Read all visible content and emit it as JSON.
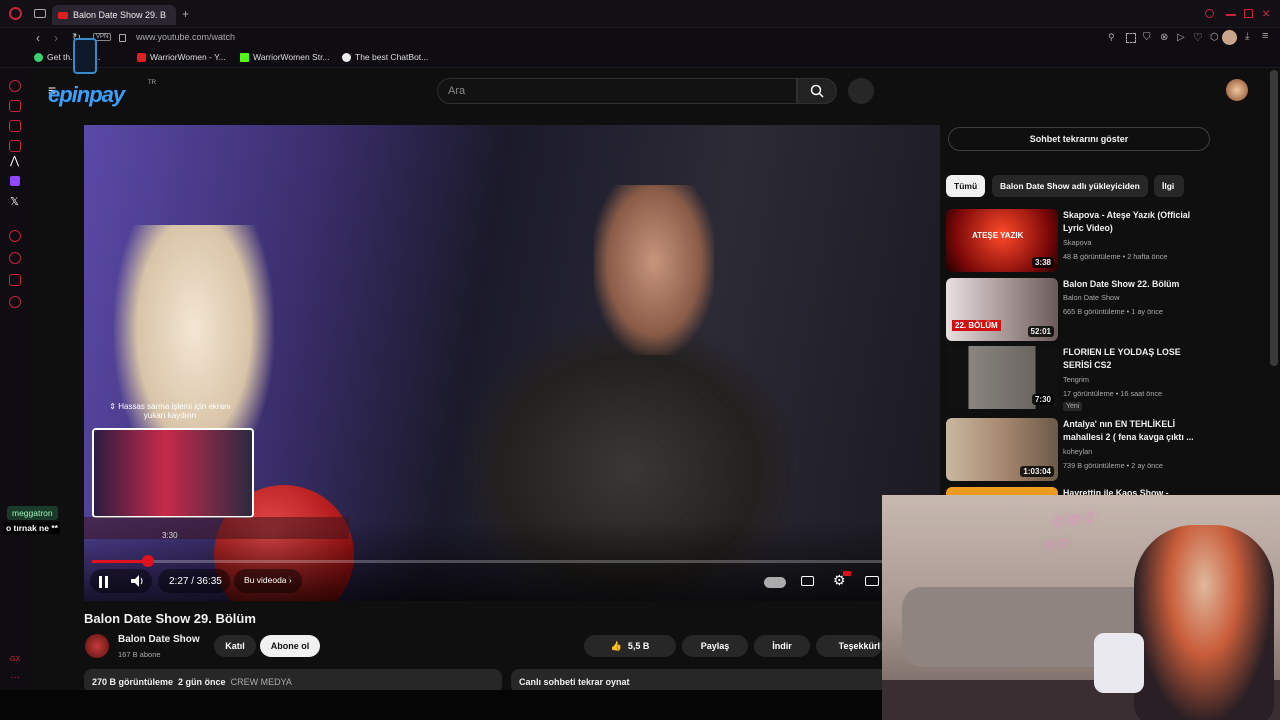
{
  "browser": {
    "tab_title": "Balon Date Show 29. B",
    "vpn_label": "VPN",
    "url": "www.youtube.com/watch",
    "bookmarks": [
      "Get th... File...",
      "WarriorWomen - Y...",
      "WarriorWomen Str...",
      "The best ChatBot..."
    ]
  },
  "youtube": {
    "logo_text": "epinpay",
    "logo_sup": "TR",
    "search_placeholder": "Ara"
  },
  "video": {
    "preview_hint": "⇕ Hassas sarma işlemi için ekranı yukarı kaydırın",
    "preview_time": "3:30",
    "current_time": "2:27 / 36:35",
    "chapter_label": "Bu videoda",
    "progress": 0.067
  },
  "meta": {
    "title": "Balon Date Show 29. Bölüm",
    "channel": "Balon Date Show",
    "subscribers": "167 B abone",
    "join": "Katıl",
    "subscribe": "Abone ol",
    "likes": "5,5 B",
    "share": "Paylaş",
    "download": "İndir",
    "thanks": "Teşekkürl",
    "views": "270 B görüntüleme",
    "date": "2 gün önce",
    "tag": "CREW MEDYA",
    "chat_replay": "Canlı sohbeti tekrar oynat"
  },
  "right": {
    "show_chat": "Sohbet tekrarını göster",
    "chips": [
      "Tümü",
      "Balon Date Show adlı yükleyiciden",
      "İlgi"
    ],
    "recommendations": [
      {
        "title": "Skapova - Ateşe Yazık (Official Lyric Video)",
        "channel": "Skapova",
        "stats": "48 B görüntüleme • 2 hafta önce",
        "duration": "3:38",
        "thumb_text": "ATEŞE YAZIK",
        "badge": ""
      },
      {
        "title": "Balon Date Show 22. Bölüm",
        "channel": "Balon Date Show",
        "stats": "665 B görüntüleme • 1 ay önce",
        "duration": "52:01",
        "thumb_text": "22. BÖLÜM",
        "badge": ""
      },
      {
        "title": "FLORIEN LE YOLDAŞ LOSE SERİSİ CS2",
        "channel": "Tengrim",
        "stats": "17 görüntüleme • 16 saat önce",
        "duration": "7:30",
        "thumb_text": "",
        "badge": "Yeni"
      },
      {
        "title": "Antalya' nın EN TEHLİKELİ mahallesi 2 ( fena kavga çıktı ...",
        "channel": "koheylan",
        "stats": "739 B görüntüleme • 2 ay önce",
        "duration": "1:03:04",
        "thumb_text": "",
        "badge": ""
      },
      {
        "title": "Hayrettin ile Kaos Show -",
        "channel": "",
        "stats": "",
        "duration": "",
        "thumb_text": "",
        "badge": ""
      }
    ]
  },
  "overlay": {
    "chat_user": "meggatron",
    "chat_message": "o tırnak ne **",
    "sidebar_bottom": "GX"
  },
  "colors": {
    "accent": "#e0121e",
    "opera": "#c7223e",
    "link": "#3aa0ff"
  }
}
